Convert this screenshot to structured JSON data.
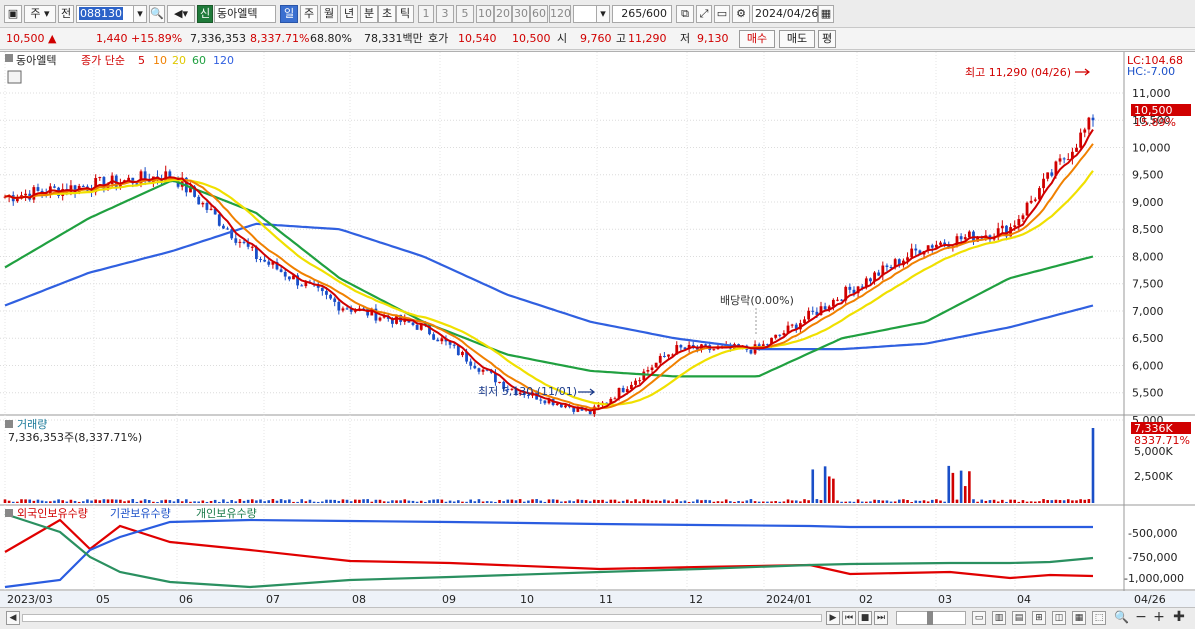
{
  "toolbar": {
    "market": "주",
    "prev_label": "전",
    "code": "088130",
    "new_badge": "신",
    "stock_name": "동아엘텍",
    "period_buttons": [
      "일",
      "주",
      "월",
      "년",
      "분",
      "초",
      "틱"
    ],
    "interval_buttons": [
      "1",
      "3",
      "5",
      "10",
      "20",
      "30",
      "60",
      "120"
    ],
    "count_value": "265",
    "count_max": "/600",
    "date_value": "2024/04/26"
  },
  "quote": {
    "price": "10,500",
    "arrow": "▲",
    "change": "1,440",
    "change_pct": "+15.89%",
    "volume": "7,336,353",
    "volume_pct": "8,337.71%",
    "turnover_rate": "68.80%",
    "amount": "78,331백만",
    "ask_label": "호가",
    "ask_price": "10,540",
    "bid_price": "10,500",
    "open_label": "시",
    "open_price": "9,760",
    "high_label": "고",
    "high_price": "11,290",
    "low_label": "저",
    "low_price": "9,130",
    "buy_label": "매수",
    "sell_label": "매도",
    "eval_label": "평"
  },
  "price_panel": {
    "legend_name": "동아엘텍",
    "legend_ma_label": "종가 단순",
    "ma_periods": [
      "5",
      "10",
      "20",
      "60",
      "120"
    ],
    "lc_label": "LC:104.68",
    "hc_label": "HC:-7.00",
    "high_annotation": "최고 11,290 (04/26)",
    "low_annotation": "최저 5,130 (11/01)",
    "dividend_annotation": "배당락(0.00%)",
    "current_price_tag": "10,500",
    "current_pct_tag": "15.89%",
    "y_ticks": [
      "11,000",
      "10,500",
      "10,000",
      "9,500",
      "9,000",
      "8,500",
      "8,000",
      "7,500",
      "7,000",
      "6,500",
      "6,000",
      "5,500",
      "5,000"
    ]
  },
  "volume_panel": {
    "title": "거래량",
    "value_text": "7,336,353주(8,337.71%)",
    "tag_value": "7,336K",
    "tag_pct": "8337.71%",
    "y_ticks": [
      "5,000K",
      "2,500K"
    ]
  },
  "holding_panel": {
    "foreign_label": "외국인보유수량",
    "inst_label": "기관보유수량",
    "indiv_label": "개인보유수량",
    "y_ticks": [
      "-500,000",
      "-750,000",
      "-1,000,000"
    ]
  },
  "x_axis": {
    "labels": [
      "2023/03",
      "05",
      "06",
      "07",
      "08",
      "09",
      "10",
      "11",
      "12",
      "2024/01",
      "02",
      "03",
      "04"
    ],
    "end_label": "04/26"
  },
  "colors": {
    "up": "#d00000",
    "down": "#1a4fc8",
    "ma5": "#d00000",
    "ma10": "#f08000",
    "ma20": "#f0e000",
    "ma60": "#20a040",
    "ma120": "#3060e0"
  },
  "chart_data": {
    "type": "line",
    "x": [
      "2023/03",
      "05",
      "06",
      "07",
      "08",
      "09",
      "10",
      "11",
      "12",
      "2024/01",
      "02",
      "03",
      "04",
      "04/26"
    ],
    "series": [
      {
        "name": "동아엘텍",
        "values": [
          9100,
          9300,
          9500,
          8000,
          7100,
          6700,
          5600,
          5130,
          6300,
          6300,
          7300,
          8200,
          8500,
          10500
        ]
      },
      {
        "name": "60",
        "values": [
          7800,
          8700,
          9400,
          8800,
          7600,
          6800,
          6200,
          5900,
          5800,
          5800,
          6500,
          6800,
          7600,
          8000
        ]
      },
      {
        "name": "120",
        "values": [
          7100,
          7700,
          8100,
          8600,
          8500,
          8000,
          7300,
          6800,
          6500,
          6300,
          6300,
          6400,
          6700,
          7100
        ]
      }
    ],
    "ylim": [
      5000,
      11000
    ]
  }
}
